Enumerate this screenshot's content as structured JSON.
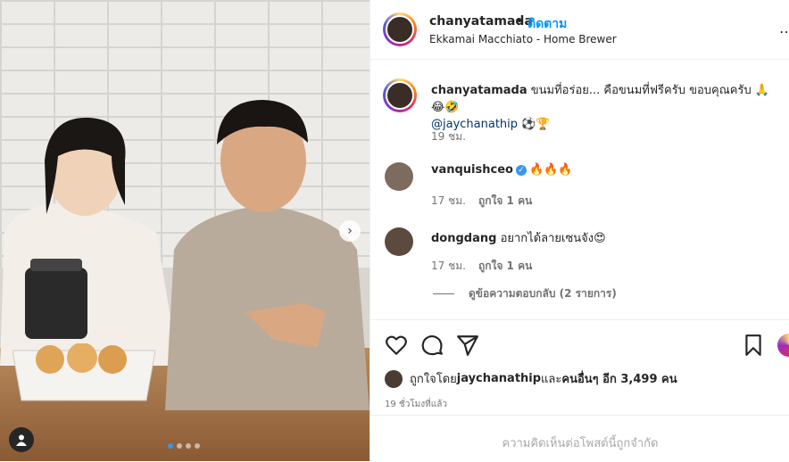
{
  "post": {
    "username": "chanyatamada",
    "separator": "•",
    "follow_label": "ติดตาม",
    "location": "Ekkamai Macchiato - Home Brewer",
    "more_icon": "…",
    "carousel": {
      "total": 4,
      "active": 1
    }
  },
  "caption": {
    "username": "chanyatamada",
    "text": " ขนมที่อร่อย... คือขนมที่ฟรีครับ ขอบคุณครับ 🙏😂🤣",
    "mention": "@jaychanathip",
    "emoji_tail": " ⚽🏆",
    "time": "19 ชม."
  },
  "comments": [
    {
      "username": "vanquishceo",
      "verified": true,
      "text": "🔥🔥🔥",
      "time": "17 ชม.",
      "likes": "ถูกใจ 1 คน"
    },
    {
      "username": "dongdang",
      "verified": false,
      "text": " อยากได้ลายเซนจัง😍",
      "time": "17 ชม.",
      "likes": "ถูกใจ 1 คน"
    }
  ],
  "replies_label": "ดูข้อความตอบกลับ (2 รายการ)",
  "likes": {
    "prefix": "ถูกใจโดย ",
    "user": "jaychanathip",
    "middle": " และ ",
    "others": "คนอื่นๆ อีก 3,499 คน"
  },
  "timestamp": "19 ชั่วโมงที่แล้ว",
  "footer_notice": "ความคิดเห็นต่อโพสต์นี้ถูกจำกัด",
  "icons": {
    "like": "heart-icon",
    "comment": "comment-icon",
    "share": "send-icon",
    "save": "bookmark-icon",
    "next": "chevron-right-icon",
    "tag": "user-tag-icon"
  },
  "colors": {
    "link": "#0095f6",
    "mention": "#00376b",
    "muted": "#737373",
    "verified": "#3897f0"
  }
}
